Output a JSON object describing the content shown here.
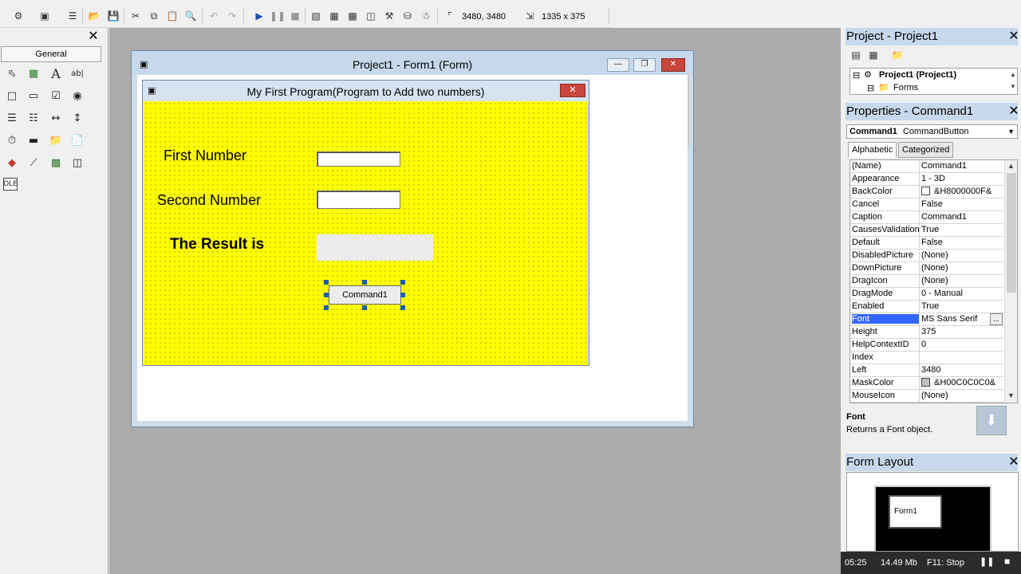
{
  "toolbar": {
    "position_readout": "3480, 3480",
    "size_readout": "1335 x 375"
  },
  "toolbox": {
    "tab_label": "General",
    "tools": [
      "pointer-icon",
      "picturebox-icon",
      "label-icon",
      "textbox-icon",
      "frame-icon",
      "commandbutton-icon",
      "checkbox-icon",
      "optionbutton-icon",
      "combobox-icon",
      "listbox-icon",
      "hscrollbar-icon",
      "vscrollbar-icon",
      "timer-icon",
      "drivelistbox-icon",
      "dirlistbox-icon",
      "filelistbox-icon",
      "shape-icon",
      "line-icon",
      "image-icon",
      "data-icon",
      "ole-icon"
    ]
  },
  "project_window": {
    "title": "Project1 - Form1 (Form)"
  },
  "form": {
    "title": "My First Program(Program to Add two numbers)",
    "labels": {
      "first": "First Number",
      "second": "Second Number",
      "result": "The Result is"
    },
    "command_caption": "Command1",
    "back_color": "#ffff00"
  },
  "project_explorer": {
    "title": "Project - Project1",
    "root": "Project1 (Project1)",
    "folder": "Forms"
  },
  "properties": {
    "title": "Properties - Command1",
    "object_name": "Command1",
    "object_type": "CommandButton",
    "tabs": [
      "Alphabetic",
      "Categorized"
    ],
    "rows": [
      {
        "name": "(Name)",
        "value": "Command1"
      },
      {
        "name": "Appearance",
        "value": "1 - 3D"
      },
      {
        "name": "BackColor",
        "value": "&H8000000F&"
      },
      {
        "name": "Cancel",
        "value": "False"
      },
      {
        "name": "Caption",
        "value": "Command1"
      },
      {
        "name": "CausesValidation",
        "value": "True"
      },
      {
        "name": "Default",
        "value": "False"
      },
      {
        "name": "DisabledPicture",
        "value": "(None)"
      },
      {
        "name": "DownPicture",
        "value": "(None)"
      },
      {
        "name": "DragIcon",
        "value": "(None)"
      },
      {
        "name": "DragMode",
        "value": "0 - Manual"
      },
      {
        "name": "Enabled",
        "value": "True"
      },
      {
        "name": "Font",
        "value": "MS Sans Serif"
      },
      {
        "name": "Height",
        "value": "375"
      },
      {
        "name": "HelpContextID",
        "value": "0"
      },
      {
        "name": "Index",
        "value": ""
      },
      {
        "name": "Left",
        "value": "3480"
      },
      {
        "name": "MaskColor",
        "value": "&H00C0C0C0&"
      },
      {
        "name": "MouseIcon",
        "value": "(None)"
      }
    ],
    "selected_row": "Font",
    "ellipsis": "...",
    "desc_title": "Font",
    "desc_text": "Returns a Font object."
  },
  "form_layout": {
    "title": "Form Layout",
    "form_label": "Form1"
  },
  "status_bar": {
    "time": "05:25",
    "memory": "14.49 Mb",
    "hint": "F11: Stop"
  }
}
